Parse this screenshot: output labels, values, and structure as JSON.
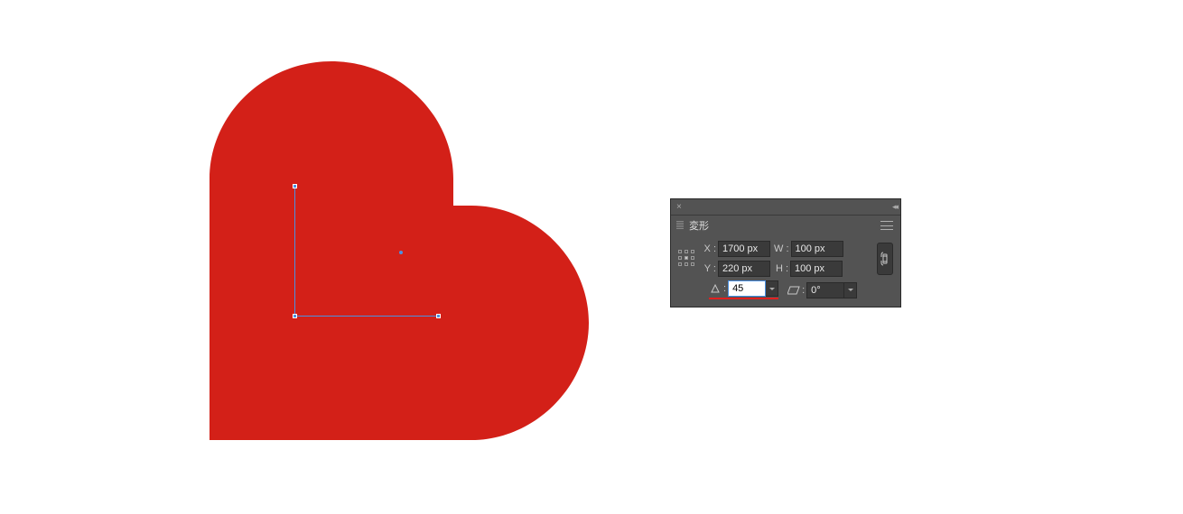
{
  "canvas": {
    "shape_color": "#d32018"
  },
  "panel": {
    "title": "変形",
    "x_label": "X :",
    "y_label": "Y :",
    "w_label": "W :",
    "h_label": "H :",
    "x_value": "1700 px",
    "y_value": "220 px",
    "w_value": "100 px",
    "h_value": "100 px",
    "rotation_value": "45",
    "shear_value": "0°"
  }
}
